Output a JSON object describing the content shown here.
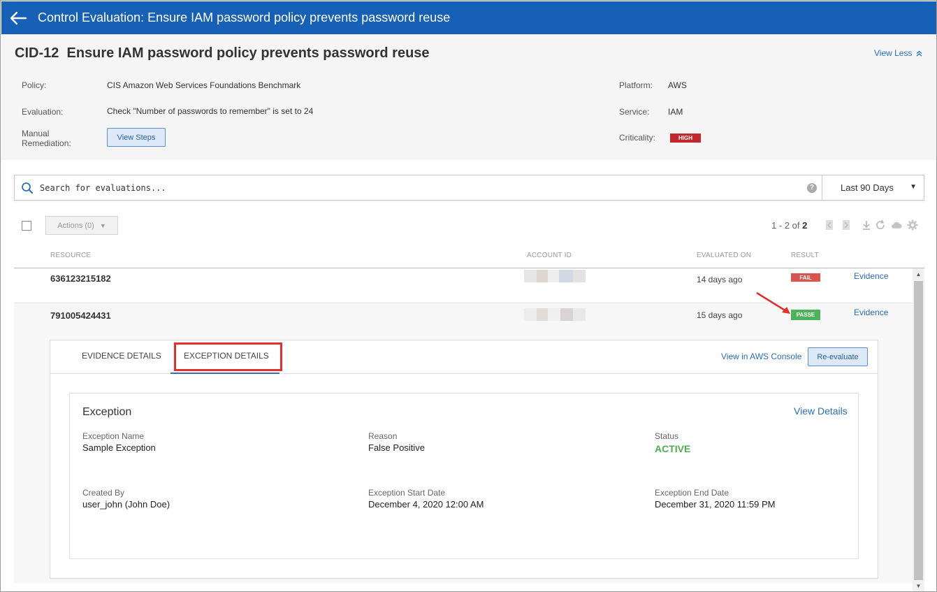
{
  "topbar": {
    "title": "Control Evaluation: Ensure IAM password policy prevents password reuse"
  },
  "header": {
    "cid": "CID-12",
    "title": "Ensure IAM password policy prevents password reuse",
    "view_less": "View Less",
    "policy_label": "Policy:",
    "policy_value": "CIS Amazon Web Services Foundations Benchmark",
    "evaluation_label": "Evaluation:",
    "evaluation_value": "Check \"Number of passwords to remember\" is set to 24",
    "manual_label_1": "Manual",
    "manual_label_2": "Remediation:",
    "view_steps": "View Steps",
    "platform_label": "Platform:",
    "platform_value": "AWS",
    "service_label": "Service:",
    "service_value": "IAM",
    "criticality_label": "Criticality:",
    "criticality_value": "HIGH",
    "criticality_color": "#c1272d"
  },
  "search": {
    "placeholder": "Search for evaluations...",
    "help": "?",
    "range": "Last 90 Days"
  },
  "toolbar": {
    "actions": "Actions (0)",
    "pager_range": "1 - 2 of ",
    "pager_total": "2"
  },
  "table": {
    "headers": {
      "resource": "RESOURCE",
      "account_id": "ACCOUNT ID",
      "evaluated_on": "EVALUATED ON",
      "result": "RESULT"
    },
    "rows": [
      {
        "resource": "636123215182",
        "evaluated_on": "14 days ago",
        "result": "FAIL",
        "evidence": "Evidence"
      },
      {
        "resource": "791005424431",
        "evaluated_on": "15 days ago",
        "result": "PASS",
        "result_suffix": "E",
        "evidence": "Evidence"
      }
    ]
  },
  "detail": {
    "tabs": [
      "EVIDENCE DETAILS",
      "EXCEPTION DETAILS"
    ],
    "active_tab": "EXCEPTION DETAILS",
    "view_in_console": "View in AWS Console",
    "reevaluate": "Re-evaluate",
    "exception": {
      "title": "Exception",
      "view_details": "View Details",
      "name_label": "Exception Name",
      "name_value": "Sample Exception",
      "reason_label": "Reason",
      "reason_value": "False Positive",
      "status_label": "Status",
      "status_value": "ACTIVE",
      "status_color": "#4cae4c",
      "created_by_label": "Created By",
      "created_by_value": "user_john (John Doe)",
      "start_label": "Exception Start Date",
      "start_value": "December 4, 2020 12:00 AM",
      "end_label": "Exception End Date",
      "end_value": "December 31, 2020 11:59 PM"
    }
  },
  "colors": {
    "brand_blue": "#1660b7",
    "link": "#2a6ebb",
    "fail": "#d9534f",
    "pass": "#4cb25b",
    "highlight": "#e0312e"
  },
  "icons": {
    "back": "arrow-left-icon",
    "search": "search-icon",
    "help": "help-icon",
    "caret": "caret-down-icon",
    "first_page": "page-prev-icon",
    "next_page": "page-next-icon",
    "download": "download-icon",
    "refresh": "refresh-icon",
    "cloud": "cloud-icon",
    "settings": "gear-icon",
    "view_less": "chevron-double-up-icon"
  }
}
